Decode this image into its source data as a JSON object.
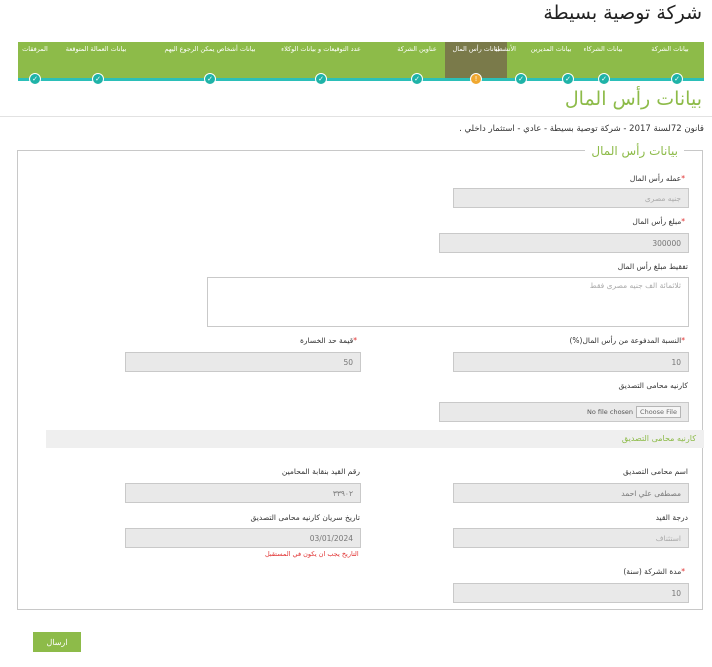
{
  "company_title": "شركة توصية بسيطة",
  "wizard": {
    "steps": [
      {
        "label": "بيانات الشركة",
        "state": "done"
      },
      {
        "label": "بيانات الشركاء",
        "state": "done"
      },
      {
        "label": "بيانات المديرين",
        "state": "done"
      },
      {
        "label": "الأنشطة",
        "state": "done"
      },
      {
        "label": "بيانات رأس المال",
        "state": "active"
      },
      {
        "label": "عناوين الشركة",
        "state": "done"
      },
      {
        "label": "عدد التوقيعات و بيانات الوكلاء",
        "state": "done"
      },
      {
        "label": "بيانات أشخاص يمكن الرجوع اليهم",
        "state": "done"
      },
      {
        "label": "بيانات العمالة المتوقعة",
        "state": "done"
      },
      {
        "label": "المرفقات",
        "state": "done"
      }
    ]
  },
  "page_heading": "بيانات رأس المال",
  "case_summary": "قانون 72لسنة 2017 - شركة توصية بسيطة - عادي - استثمار داخلي .",
  "legend": "بيانات رأس المال",
  "fields": {
    "currency": {
      "label": "عمله رأس المال",
      "value": "جنيه مصرى"
    },
    "capital_amount": {
      "label": "مبلغ رأس المال",
      "value": "300000"
    },
    "amount_in_words": {
      "label": "تفقيط مبلغ رأس المال",
      "value": "ثلاثمائة الف جنيه مصرى فقط"
    },
    "paid_percentage": {
      "label": "النسبة المدفوعة من رأس المال(%)",
      "value": "10"
    },
    "loss_limit": {
      "label": "قيمة حد الخسارة",
      "value": "50"
    },
    "lawyer_card": {
      "label": "كارنيه محامى التصديق",
      "file_button": "Choose File",
      "file_text": "No file chosen"
    },
    "lawyer_name": {
      "label": "اسم محامى التصديق",
      "value": "مصطفى علي احمد"
    },
    "syndicate_number": {
      "label": "رقم القيد بنقابة المحامين",
      "value": "٣٣٩٠٢"
    },
    "registration_degree": {
      "label": "درجة القيد",
      "value": "استئناف"
    },
    "card_validity_date": {
      "label": "تاريخ سريان كارنيه محامى التصديق",
      "value": "03/01/2024",
      "error": "التاريخ يجب ان يكون في المستقبل"
    },
    "company_duration": {
      "label": "مدة الشركة (سنة)",
      "value": "10"
    }
  },
  "section_title": "كارنيه محامى التصديق",
  "required_mark": "*",
  "submit_label": "ارسال",
  "colors": {
    "accent": "#8dbb49",
    "teal": "#2bbfb8",
    "active_step": "#f0a830",
    "error": "#e03030"
  }
}
